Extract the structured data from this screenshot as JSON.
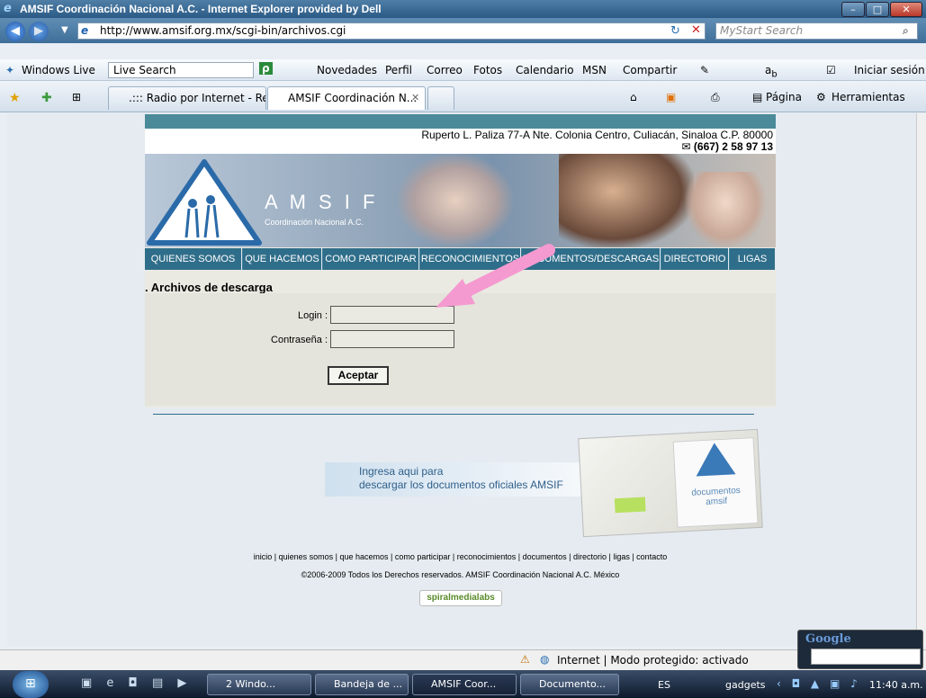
{
  "window": {
    "title": "AMSIF Coordinación Nacional A.C. - Internet Explorer provided by Dell"
  },
  "address_bar": {
    "url": "http://www.amsif.org.mx/scgi-bin/archivos.cgi",
    "search_placeholder": "MyStart Search"
  },
  "links_toolbar": {
    "windows_live": "Windows Live",
    "live_search_placeholder": "Live Search",
    "items": [
      "Novedades",
      "Perfil",
      "Correo",
      "Fotos",
      "Calendario",
      "MSN",
      "Compartir"
    ],
    "signin": "Iniciar sesión"
  },
  "tabs": [
    {
      "label": ".::: Radio por Internet - Red..."
    },
    {
      "label": "AMSIF Coordinación N..."
    }
  ],
  "command_bar": {
    "page": "Página",
    "tools": "Herramientas"
  },
  "site": {
    "address": "Ruperto L. Paliza 77-A Nte. Colonia Centro, Culiacán, Sinaloa C.P. 80000",
    "phone": "(667) 2 58 97 13",
    "logo_text": "A M S I F",
    "logo_sub": "Coordinación Nacional A.C.",
    "nav": [
      "QUIENES SOMOS",
      "QUE HACEMOS",
      "COMO PARTICIPAR",
      "RECONOCIMIENTOS",
      "DOCUMENTOS/DESCARGAS",
      "DIRECTORIO",
      "LIGAS"
    ],
    "form_title": ". Archivos de descarga",
    "login_label": "Login :",
    "password_label": "Contraseña :",
    "submit_label": "Aceptar",
    "download_line1": "Ingresa aqui para",
    "download_line2": "descargar los documentos oficiales AMSIF",
    "folder_text1": "documentos",
    "folder_text2": "amsif",
    "footer_links": "inicio | quienes somos | que hacemos | como participar | reconocimientos | documentos | directorio | ligas | contacto",
    "copyright": "©2006-2009 Todos los Derechos reservados. AMSIF Coordinación Nacional A.C. México",
    "badge": "spiralmedialabs"
  },
  "status_bar": {
    "zone": "Internet | Modo protegido: activado"
  },
  "taskbar": {
    "items": [
      "2 Windo...",
      "Bandeja de ...",
      "AMSIF Coor...",
      "Documento..."
    ],
    "lang": "ES",
    "gadgets": "gadgets",
    "time": "11:40 a.m."
  },
  "google_gadget": {
    "label": "Google"
  },
  "colors": {
    "site_nav": "#2f6e8a",
    "arrow": "#f59ad0",
    "title_bar": "#3a6a95"
  }
}
